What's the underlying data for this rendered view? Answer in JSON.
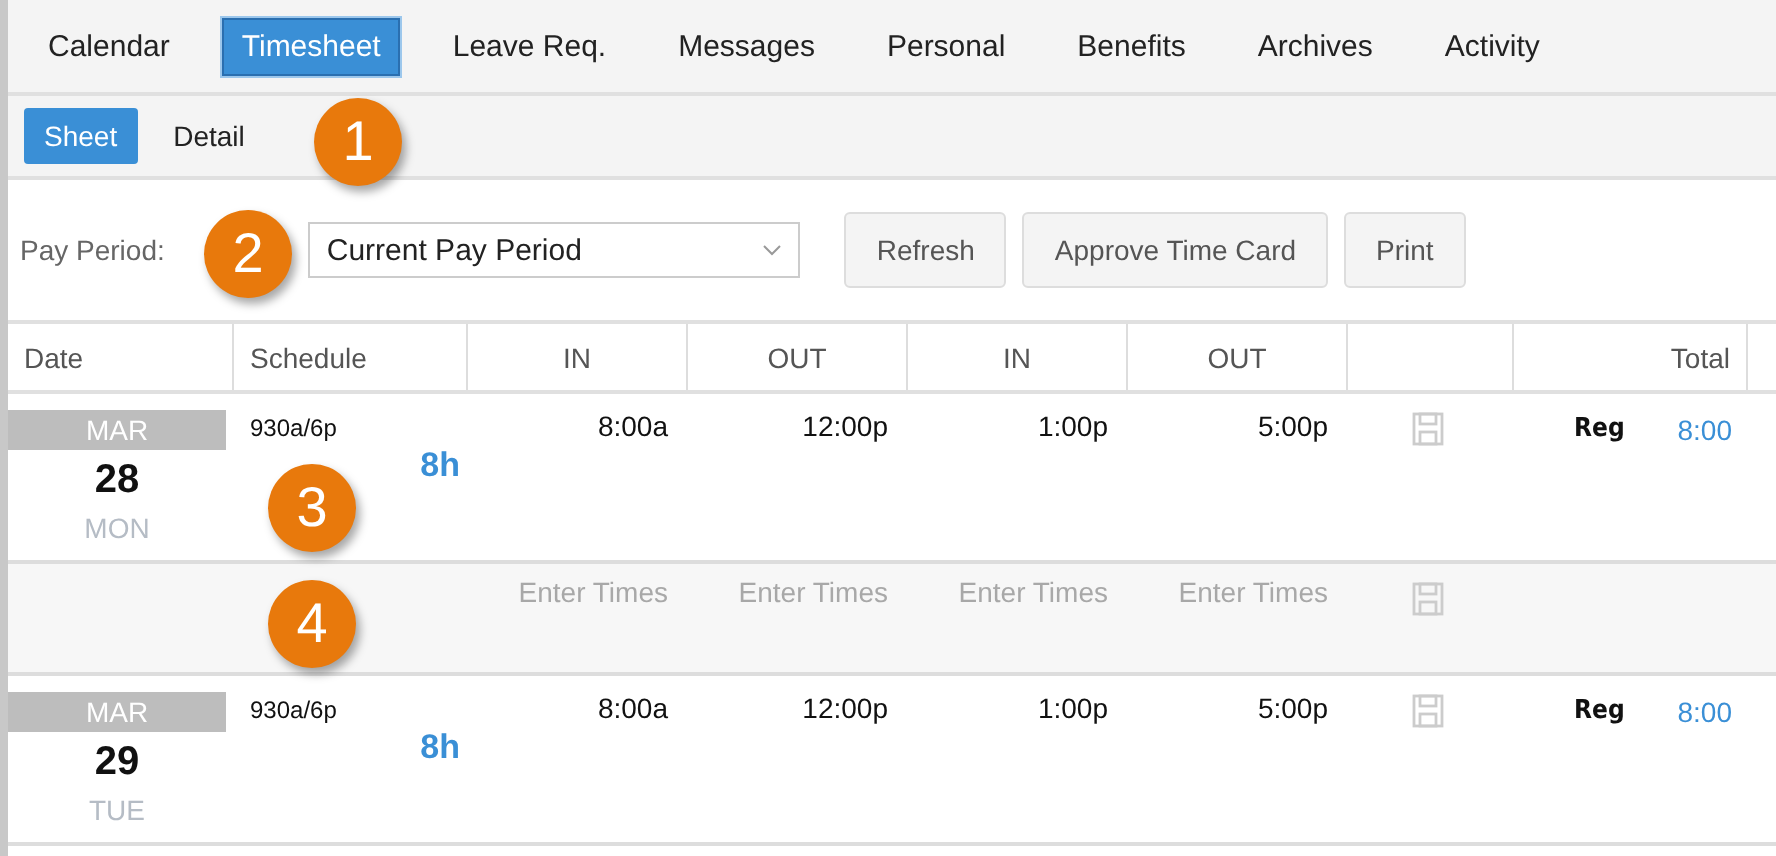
{
  "tabs": [
    {
      "label": "Calendar",
      "selected": false
    },
    {
      "label": "Timesheet",
      "selected": true
    },
    {
      "label": "Leave Req.",
      "selected": false
    },
    {
      "label": "Messages",
      "selected": false
    },
    {
      "label": "Personal",
      "selected": false
    },
    {
      "label": "Benefits",
      "selected": false
    },
    {
      "label": "Archives",
      "selected": false
    },
    {
      "label": "Activity",
      "selected": false
    }
  ],
  "subtabs": [
    {
      "label": "Sheet",
      "selected": true
    },
    {
      "label": "Detail",
      "selected": false
    }
  ],
  "pay_period": {
    "label": "Pay Period:",
    "value": "Current Pay Period"
  },
  "buttons": [
    "Refresh",
    "Approve Time Card",
    "Print"
  ],
  "table": {
    "columns": [
      "Date",
      "Schedule",
      "IN",
      "OUT",
      "IN",
      "OUT",
      "",
      "Total"
    ],
    "rows": [
      {
        "kind": "day",
        "month": "MAR",
        "day": "28",
        "weekday": "MON",
        "schedule": "930a/6p",
        "hours": "8h",
        "times": [
          "8:00a",
          "12:00p",
          "1:00p",
          "5:00p"
        ],
        "code": "Reg",
        "total": "8:00"
      },
      {
        "kind": "entry",
        "placeholders": [
          "Enter Times",
          "Enter Times",
          "Enter Times",
          "Enter Times"
        ]
      },
      {
        "kind": "day",
        "month": "MAR",
        "day": "29",
        "weekday": "TUE",
        "schedule": "930a/6p",
        "hours": "8h",
        "times": [
          "8:00a",
          "12:00p",
          "1:00p",
          "5:00p"
        ],
        "code": "Reg",
        "total": "8:00"
      }
    ]
  },
  "callouts": [
    "1",
    "2",
    "3",
    "4"
  ]
}
